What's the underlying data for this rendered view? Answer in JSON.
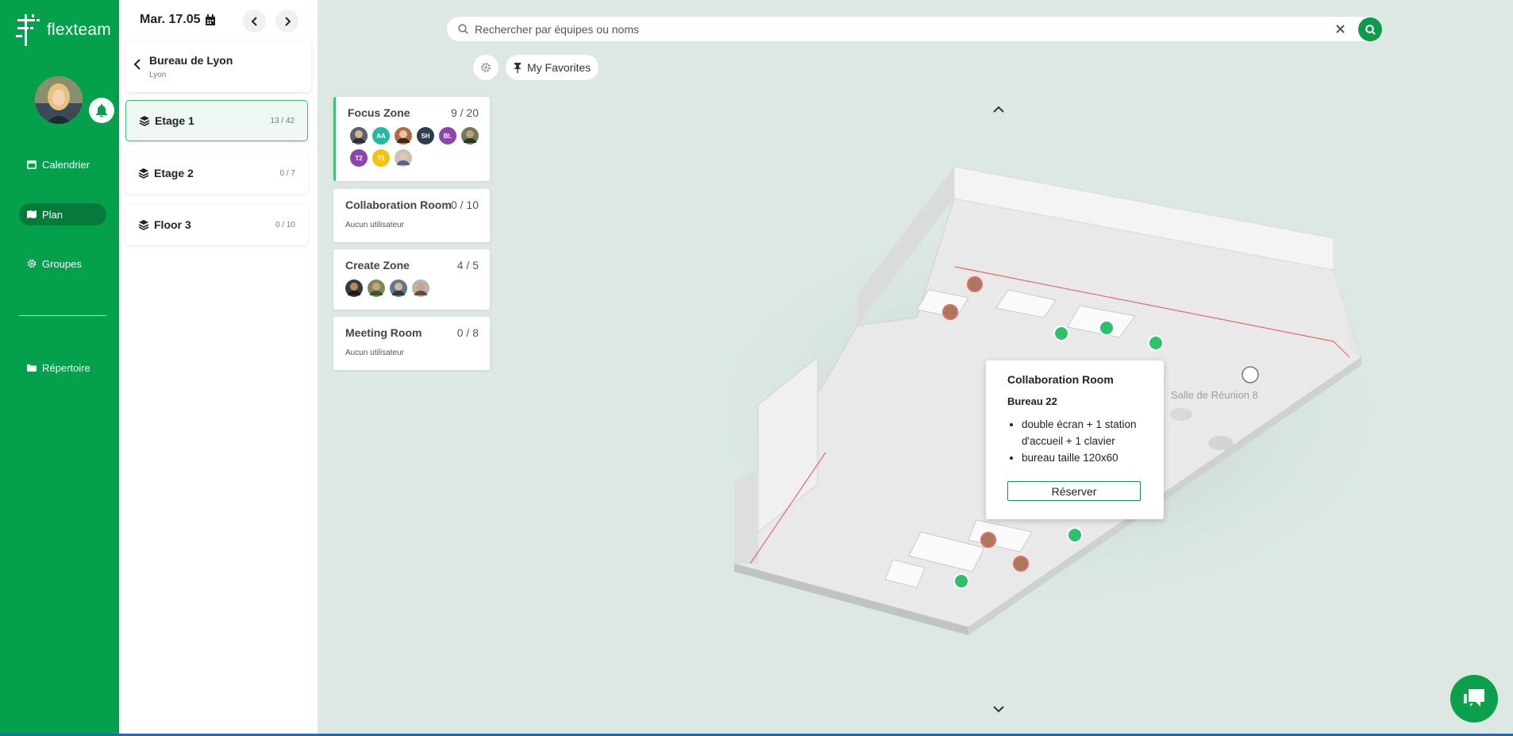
{
  "app": {
    "name": "flexteam"
  },
  "nav": {
    "items": [
      {
        "label": "Calendrier",
        "icon": "calendar-icon"
      },
      {
        "label": "Plan",
        "icon": "map-icon"
      },
      {
        "label": "Groupes",
        "icon": "gear-icon"
      },
      {
        "label": "Répertoire",
        "icon": "folder-icon"
      }
    ],
    "active": "Plan"
  },
  "header": {
    "date": "Mar. 17.05"
  },
  "site": {
    "name": "Bureau de Lyon",
    "city": "Lyon"
  },
  "floors": [
    {
      "name": "Etage 1",
      "count": "13 / 42"
    },
    {
      "name": "Etage 2",
      "count": "0 / 7"
    },
    {
      "name": "Floor 3",
      "count": "0 / 10"
    }
  ],
  "search": {
    "placeholder": "Rechercher par équipes ou noms"
  },
  "favorites": {
    "label": "My Favorites"
  },
  "zones": [
    {
      "name": "Focus Zone",
      "count": "9 / 20",
      "avatars": [
        "",
        "AA",
        "",
        "SH",
        "BL",
        "",
        "T2",
        "T1",
        ""
      ]
    },
    {
      "name": "Collaboration Room",
      "count": "0 / 10",
      "empty": "Aucun utilisateur"
    },
    {
      "name": "Create Zone",
      "count": "4 / 5"
    },
    {
      "name": "Meeting Room",
      "count": "0 / 8",
      "empty": "Aucun utilisateur"
    }
  ],
  "map": {
    "room_label": "Salle de Réunion 8"
  },
  "popup": {
    "title": "Collaboration Room",
    "desk": "Bureau 22",
    "features": [
      "double écran + 1 station d'accueil + 1 clavier",
      "bureau taille 120x60"
    ],
    "button": "Réserver"
  },
  "colors": {
    "brand": "#05a04b",
    "dark_brand": "#067a3a",
    "background": "#dde8e3"
  }
}
